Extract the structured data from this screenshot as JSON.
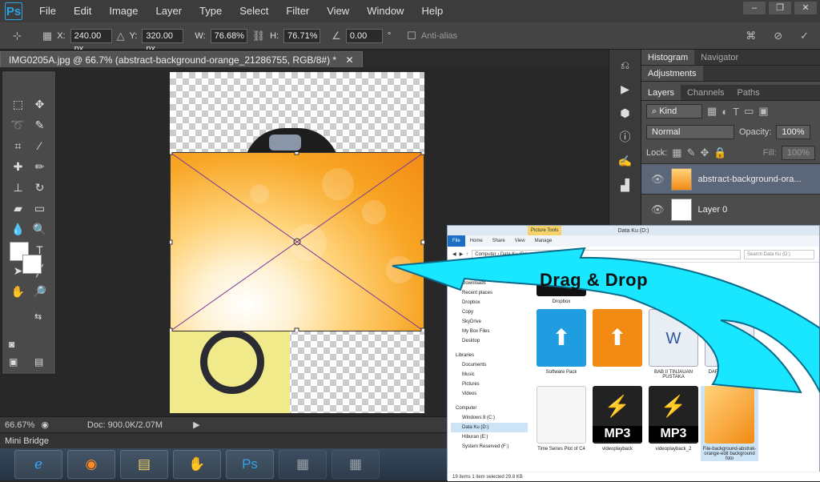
{
  "menubar": {
    "logo": "Ps",
    "items": [
      "File",
      "Edit",
      "Image",
      "Layer",
      "Type",
      "Select",
      "Filter",
      "View",
      "Window",
      "Help"
    ]
  },
  "options": {
    "x_label": "X:",
    "x_value": "240.00 px",
    "y_label": "Y:",
    "y_value": "320.00 px",
    "w_label": "W:",
    "w_value": "76.68%",
    "h_label": "H:",
    "h_value": "76.71%",
    "angle_value": "0.00",
    "degree_symbol": "°",
    "antialias_label": "Anti-alias"
  },
  "document": {
    "tab_title": "IMG0205A.jpg @ 66.7% (abstract-background-orange_21286755, RGB/8#) *"
  },
  "status": {
    "zoom": "66.67%",
    "doc_info": "Doc: 900.0K/2.07M"
  },
  "minibridge": {
    "label": "Mini Bridge"
  },
  "panels": {
    "top_tabs": [
      "Histogram",
      "Navigator"
    ],
    "adjustments_tab": "Adjustments",
    "layer_tabs": [
      "Layers",
      "Channels",
      "Paths"
    ],
    "kind_label": "Kind",
    "blend_mode": "Normal",
    "opacity_label": "Opacity:",
    "opacity_value": "100%",
    "lock_label": "Lock:",
    "fill_label": "Fill:",
    "fill_value": "100%",
    "layers": [
      {
        "name": "abstract-background-ora..."
      },
      {
        "name": "Layer 0"
      }
    ]
  },
  "explorer": {
    "title": "Data Ku (D:)",
    "picture_tools": "Picture Tools",
    "ribbon": [
      "File",
      "Home",
      "Share",
      "View",
      "Manage"
    ],
    "path": "Computer › Data Ku (D:)",
    "search_placeholder": "Search Data Ku (D:)",
    "nav": {
      "favorites": [
        "Downloads",
        "Recent places",
        "Dropbox",
        "Copy",
        "SkyDrive",
        "My Box Files",
        "Desktop"
      ],
      "libraries_header": "Libraries",
      "libraries": [
        "Documents",
        "Music",
        "Pictures",
        "Videos"
      ],
      "computer_header": "Computer",
      "drives": [
        "Windows 8 (C:)",
        "Data Ku (D:)",
        "Hiburan (E:)",
        "System Reserved (F:)"
      ]
    },
    "files": [
      {
        "label": "Dropbox"
      },
      {
        "label": "Software Pack"
      },
      {
        "label": "BAB II TINJAUAN PUSTAKA"
      },
      {
        "label": "DAFTAR PUSTAKA"
      },
      {
        "label": "Time Series Plot of C4"
      },
      {
        "label": "videoplayback"
      },
      {
        "label": "videoplayback_2"
      },
      {
        "label": "File-background-abstrak-orange-edit background foto"
      }
    ],
    "mp3_badge": "MP3",
    "status": "19 items     1 item selected  29.8 KB"
  },
  "annotation": {
    "drag_drop": "Drag & Drop"
  },
  "colors": {
    "arrow": "#19e6ff",
    "accent": "#2ea4e6"
  }
}
